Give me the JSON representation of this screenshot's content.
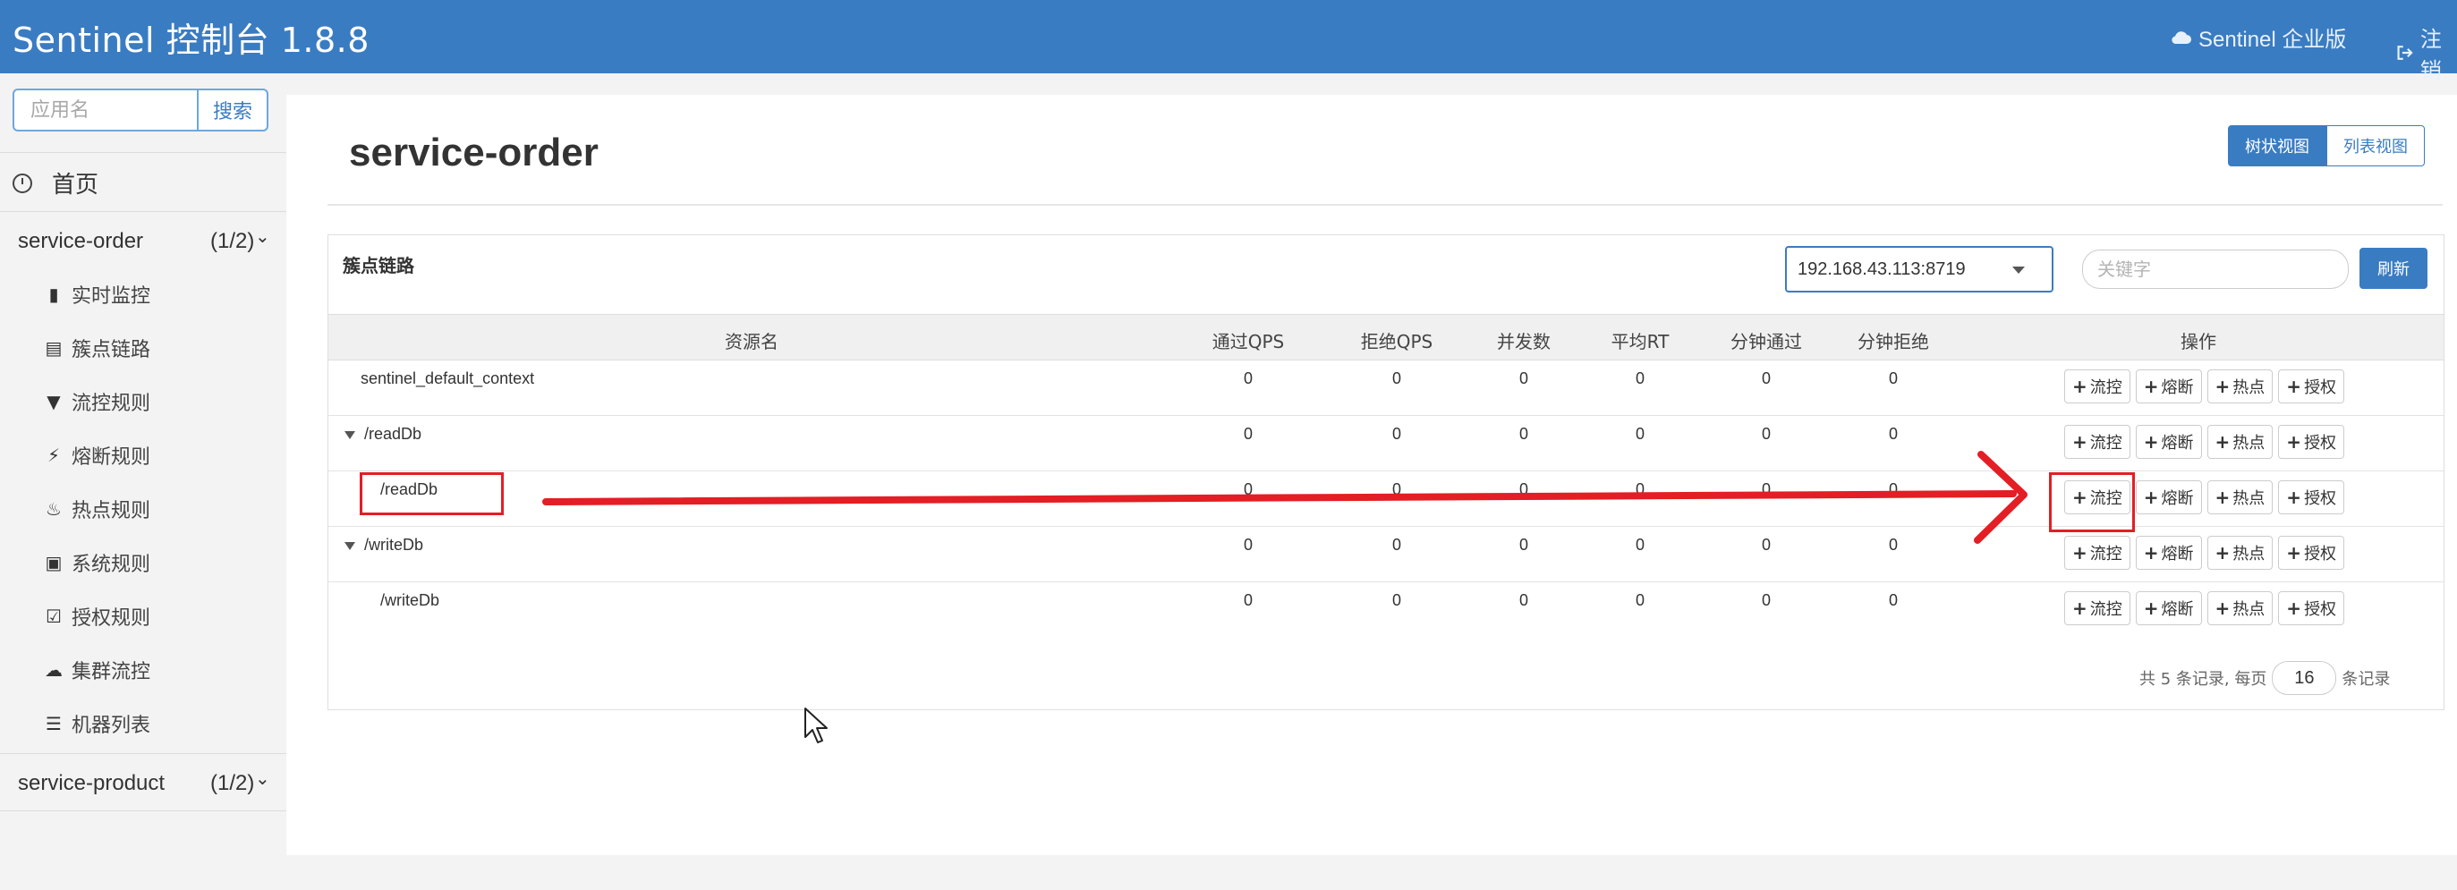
{
  "header": {
    "brand": "Sentinel 控制台 1.8.8",
    "enterprise_label": "Sentinel 企业版",
    "logout_label": "注销"
  },
  "sidebar": {
    "search_placeholder": "应用名",
    "search_button": "搜索",
    "home_label": "首页",
    "apps": [
      {
        "name": "service-order",
        "count": "(1/2)",
        "expanded": true
      },
      {
        "name": "service-product",
        "count": "(1/2)",
        "expanded": false
      }
    ],
    "menu": [
      {
        "label": "实时监控",
        "icon": "bar-chart-icon"
      },
      {
        "label": "簇点链路",
        "icon": "list-icon"
      },
      {
        "label": "流控规则",
        "icon": "filter-icon"
      },
      {
        "label": "熔断规则",
        "icon": "bolt-icon"
      },
      {
        "label": "热点规则",
        "icon": "fire-icon"
      },
      {
        "label": "系统规则",
        "icon": "lock-icon"
      },
      {
        "label": "授权规则",
        "icon": "check-square-icon"
      },
      {
        "label": "集群流控",
        "icon": "cloud-icon"
      },
      {
        "label": "机器列表",
        "icon": "list-ul-icon"
      }
    ]
  },
  "main": {
    "title": "service-order",
    "view_tree": "树状视图",
    "view_list": "列表视图",
    "card_title": "簇点链路",
    "machine": "192.168.43.113:8719",
    "keyword_placeholder": "关键字",
    "refresh": "刷新",
    "columns": [
      "资源名",
      "通过QPS",
      "拒绝QPS",
      "并发数",
      "平均RT",
      "分钟通过",
      "分钟拒绝",
      "操作"
    ],
    "rows": [
      {
        "name": "sentinel_default_context",
        "level": 0,
        "toggle": false,
        "values": [
          "0",
          "0",
          "0",
          "0",
          "0",
          "0"
        ]
      },
      {
        "name": "/readDb",
        "level": 0,
        "toggle": true,
        "values": [
          "0",
          "0",
          "0",
          "0",
          "0",
          "0"
        ]
      },
      {
        "name": "/readDb",
        "level": 1,
        "toggle": false,
        "values": [
          "0",
          "0",
          "0",
          "0",
          "0",
          "0"
        ]
      },
      {
        "name": "/writeDb",
        "level": 0,
        "toggle": true,
        "values": [
          "0",
          "0",
          "0",
          "0",
          "0",
          "0"
        ]
      },
      {
        "name": "/writeDb",
        "level": 1,
        "toggle": false,
        "values": [
          "0",
          "0",
          "0",
          "0",
          "0",
          "0"
        ]
      }
    ],
    "ops": [
      "流控",
      "熔断",
      "热点",
      "授权"
    ],
    "pager": {
      "prefix": "共 5 条记录, 每页",
      "page_size": "16",
      "suffix": "条记录"
    }
  },
  "colors": {
    "brand_blue": "#3a7cc2",
    "annotation_red": "#e31e24"
  }
}
